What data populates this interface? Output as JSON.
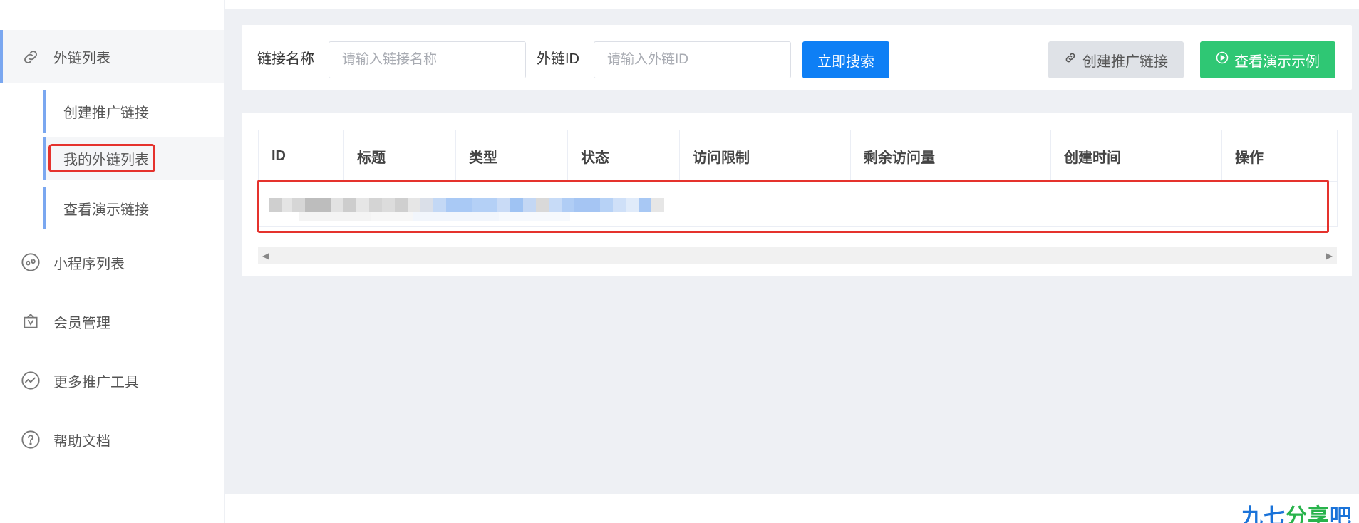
{
  "sidebar": {
    "menu": [
      {
        "label": "外链列表",
        "icon": "link-icon"
      },
      {
        "label": "小程序列表",
        "icon": "miniprogram-icon"
      },
      {
        "label": "会员管理",
        "icon": "vip-bag-icon"
      },
      {
        "label": "更多推广工具",
        "icon": "trend-icon"
      },
      {
        "label": "帮助文档",
        "icon": "help-icon"
      }
    ],
    "submenu": [
      {
        "label": "创建推广链接"
      },
      {
        "label": "我的外链列表"
      },
      {
        "label": "查看演示链接"
      }
    ]
  },
  "search": {
    "name_label": "链接名称",
    "name_placeholder": "请输入链接名称",
    "id_label": "外链ID",
    "id_placeholder": "请输入外链ID",
    "search_button": "立即搜索",
    "create_button": "创建推广链接",
    "demo_button": "查看演示示例"
  },
  "table": {
    "headers": [
      "ID",
      "标题",
      "类型",
      "状态",
      "访问限制",
      "剩余访问量",
      "创建时间",
      "操作"
    ]
  },
  "colors": {
    "primary": "#0e7ff5",
    "green": "#2fc774",
    "highlight": "#e5322d"
  },
  "watermark": {
    "part1": "九七",
    "part2": "分享",
    "part3": "吧"
  }
}
